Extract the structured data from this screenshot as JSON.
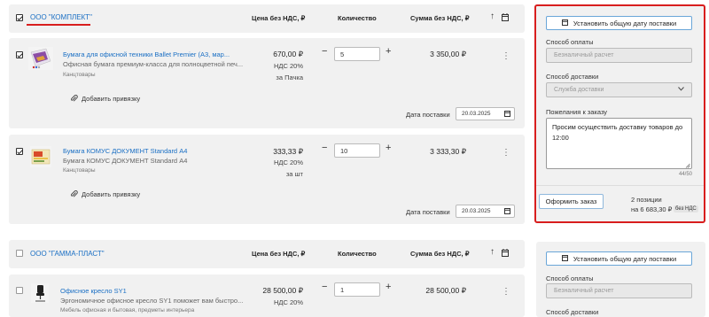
{
  "columns": {
    "price": "Цена без НДС, ₽",
    "qty": "Количество",
    "sum": "Сумма без НДС, ₽"
  },
  "groups": [
    {
      "company": "ООО \"КОМПЛЕКТ\"",
      "items": [
        {
          "title": "Бумага для офисной техники Ballet Premier (А3, мар...",
          "desc": "Офисная бумага премиум-класса для полноцветной печ...",
          "category": "Канцтовары",
          "price": "670,00 ₽",
          "vat": "НДС 20%",
          "unit": "за Пачка",
          "qty": "5",
          "sum": "3 350,00 ₽",
          "bind_label": "Добавить привязку",
          "date_label": "Дата поставки",
          "date": "20.03.2025"
        },
        {
          "title": "Бумага КОМУС ДОКУМЕНТ Standard А4",
          "desc": "Бумага КОМУС ДОКУМЕНТ Standard А4",
          "category": "Канцтовары",
          "price": "333,33 ₽",
          "vat": "НДС 20%",
          "unit": "за шт",
          "qty": "10",
          "sum": "3 333,30 ₽",
          "bind_label": "Добавить привязку",
          "date_label": "Дата поставки",
          "date": "20.03.2025"
        }
      ]
    },
    {
      "company": "ООО \"ГАММА-ПЛАСТ\"",
      "items": [
        {
          "title": "Офисное кресло SY1",
          "desc": "Эргономичное офисное кресло SY1 поможет вам быстро...",
          "category": "Мебель офисная и бытовая, предметы интерьера",
          "price": "28 500,00 ₽",
          "vat": "НДС 20%",
          "qty": "1",
          "sum": "28 500,00 ₽"
        }
      ]
    }
  ],
  "panels": [
    {
      "set_date_button": "Установить общую дату поставки",
      "payment_label": "Способ оплаты",
      "payment_value": "Безналичный расчет",
      "delivery_label": "Способ доставки",
      "delivery_value": "Служба доставки",
      "wishes_label": "Пожелания к заказу",
      "wishes_value": "Просим осуществить доставку товаров до 12:00",
      "char_count": "44/50",
      "order_button": "Оформить заказ",
      "positions": "2 позиции",
      "total": "на 6 683,30 ₽",
      "vat_badge": "без НДС"
    },
    {
      "set_date_button": "Установить общую дату поставки",
      "payment_label": "Способ оплаты",
      "payment_value": "Безналичный расчет",
      "delivery_label": "Способ доставки"
    }
  ],
  "accent_color": "#1a6fc4",
  "highlight_color": "#d81e1e"
}
